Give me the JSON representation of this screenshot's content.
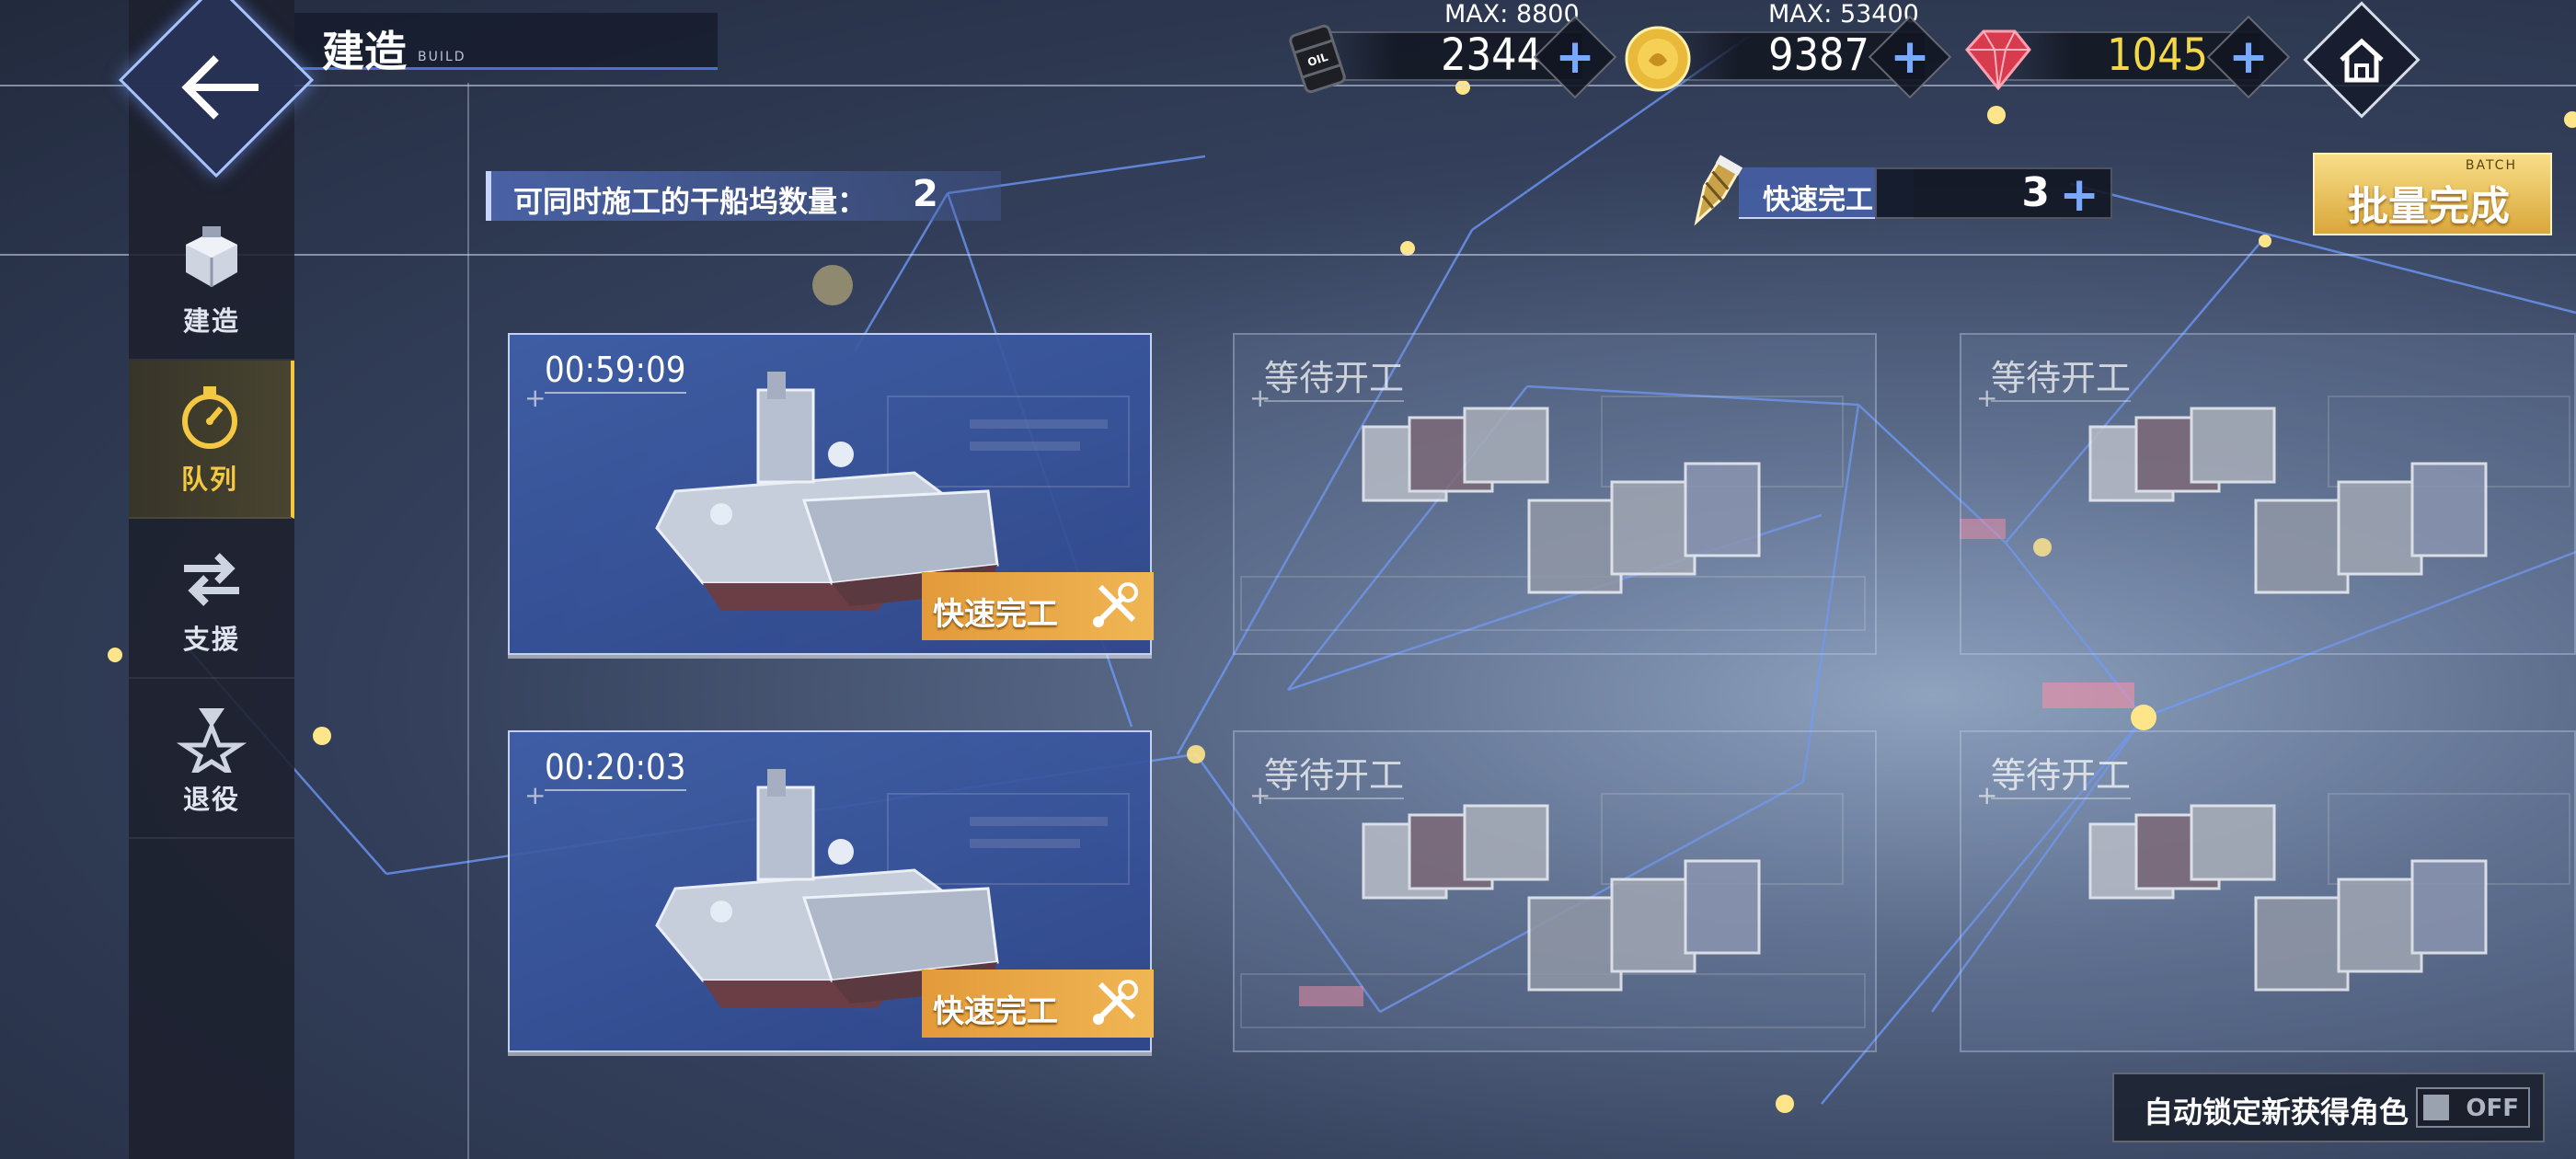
{
  "header": {
    "title": "建造",
    "subtitle": "BUILD"
  },
  "resources": [
    {
      "name": "oil",
      "icon": "oil-barrel-icon",
      "max_label": "MAX: 8800",
      "value": "2344",
      "color": "#ffffff"
    },
    {
      "name": "coins",
      "icon": "gold-coin-icon",
      "max_label": "MAX: 53400",
      "value": "9387",
      "color": "#ffffff"
    },
    {
      "name": "gems",
      "icon": "red-gem-icon",
      "max_label": "",
      "value": "1045",
      "color": "#f3d84a"
    }
  ],
  "sidebar": {
    "items": [
      {
        "label": "建造",
        "icon": "build-box-icon",
        "active": false
      },
      {
        "label": "队列",
        "icon": "stopwatch-icon",
        "active": true
      },
      {
        "label": "支援",
        "icon": "swap-arrows-icon",
        "active": false
      },
      {
        "label": "退役",
        "icon": "star-flask-icon",
        "active": false
      }
    ]
  },
  "info": {
    "dock_label": "可同时施工的干船坞数量：",
    "dock_count": "2",
    "quick_finish_label": "快速完工",
    "quick_finish_count": "3",
    "batch_small": "BATCH",
    "batch_label": "批量完成"
  },
  "docks": [
    {
      "state": "building",
      "timer": "00:59:09",
      "button": "快速完工"
    },
    {
      "state": "idle",
      "label": "等待开工"
    },
    {
      "state": "idle",
      "label": "等待开工"
    },
    {
      "state": "building",
      "timer": "00:20:03",
      "button": "快速完工"
    },
    {
      "state": "idle",
      "label": "等待开工"
    },
    {
      "state": "idle",
      "label": "等待开工"
    }
  ],
  "auto_lock": {
    "label": "自动锁定新获得角色",
    "toggle": "OFF"
  },
  "colors": {
    "accent_blue": "#79a8ff",
    "gold": "#f5c842",
    "quick_button": "#e9a445"
  }
}
